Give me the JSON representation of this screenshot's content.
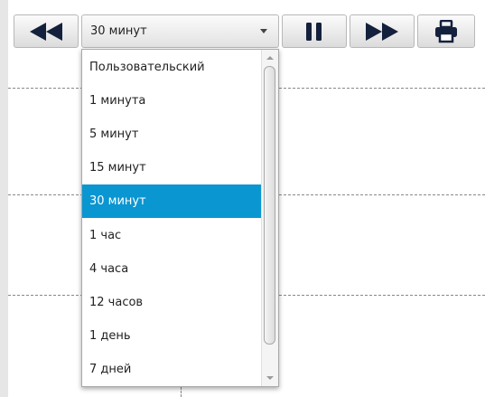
{
  "colors": {
    "selected_bg": "#0a96d1",
    "icon": "#14213d"
  },
  "toolbar": {
    "rewind_icon": "rewind-icon",
    "pause_icon": "pause-icon",
    "forward_icon": "fast-forward-icon",
    "print_icon": "printer-icon"
  },
  "interval_select": {
    "value": "30 минут",
    "options": [
      "Пользовательский",
      "1 минута",
      "5 минут",
      "15 минут",
      "30 минут",
      "1 час",
      "4 часа",
      "12 часов",
      "1 день",
      "7 дней"
    ],
    "selected_index": 4
  }
}
